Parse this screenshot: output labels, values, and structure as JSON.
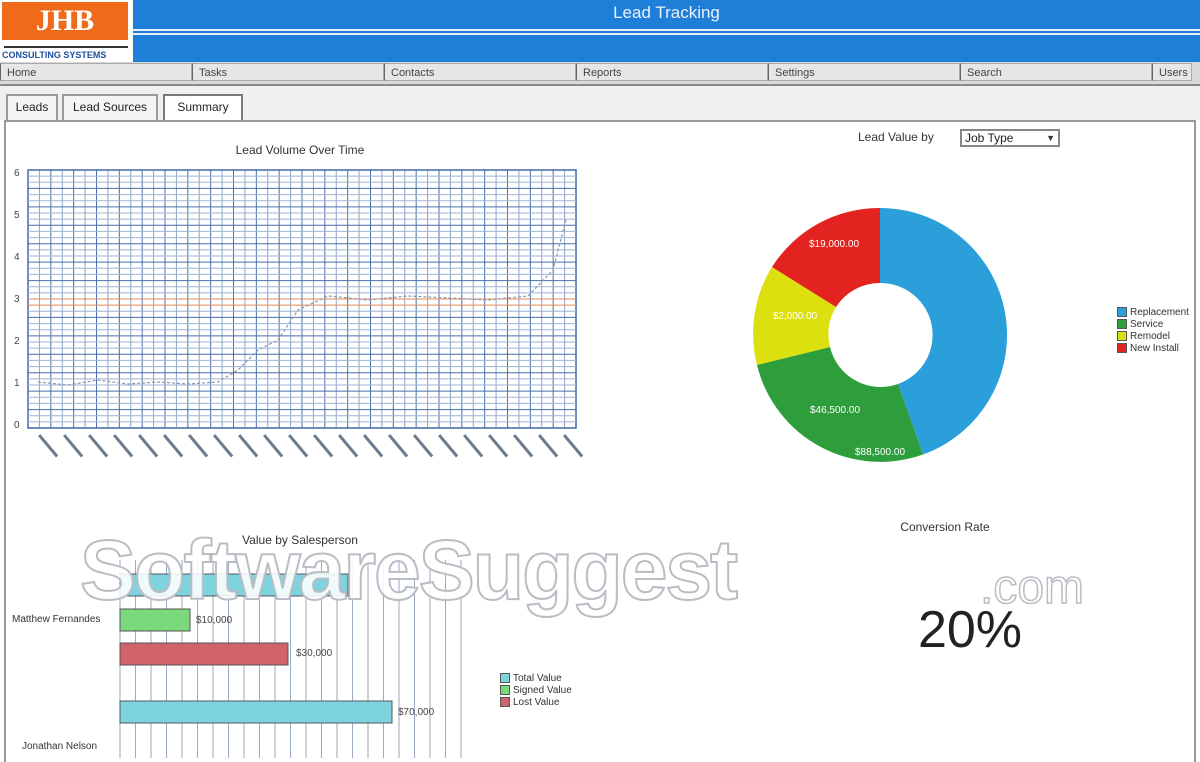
{
  "header": {
    "logo_text": "JHB",
    "logo_subtitle": "CONSULTING SYSTEMS",
    "title": "Lead Tracking"
  },
  "nav": {
    "items": [
      "Home",
      "Tasks",
      "Contacts",
      "Reports",
      "Settings",
      "Search",
      "Users"
    ]
  },
  "tabs": [
    {
      "label": "Leads",
      "active": false
    },
    {
      "label": "Lead Sources",
      "active": false
    },
    {
      "label": "Summary",
      "active": true
    }
  ],
  "lead_volume": {
    "title": "Lead Volume Over Time",
    "yticks": [
      "6",
      "5",
      "4",
      "3",
      "2",
      "1",
      "0"
    ]
  },
  "lead_value": {
    "label": "Lead Value by",
    "select_value": "Job Type",
    "slice_labels": [
      "$88,500.00",
      "$46,500.00",
      "$2,000.00",
      "$19,000.00"
    ],
    "legend": [
      "Replacement",
      "Service",
      "Remodel",
      "New Install"
    ],
    "colors": [
      "#2b9fd9",
      "#2e9e3c",
      "#dde00f",
      "#e2231f"
    ]
  },
  "bar_chart": {
    "title": "Value by Salesperson",
    "y_labels": [
      "Matthew Fernandes",
      "Jonathan Nelson"
    ],
    "bar_labels": [
      "$10,000",
      "$30,000",
      "$70,000"
    ],
    "legend": [
      "Total Value",
      "Signed Value",
      "Lost Value"
    ],
    "colors": [
      "#7dd3de",
      "#7cd87c",
      "#d2636b"
    ]
  },
  "conversion": {
    "title": "Conversion Rate",
    "value": "20%"
  },
  "watermark": {
    "text": "SoftwareSuggest",
    "suffix": ".com"
  }
}
